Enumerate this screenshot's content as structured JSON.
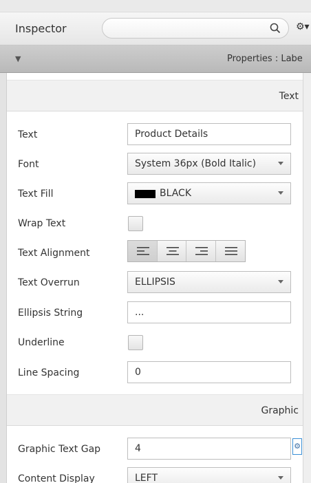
{
  "header": {
    "title": "Inspector",
    "search_placeholder": ""
  },
  "properties_bar": {
    "title": "Properties : Labe"
  },
  "sections": {
    "text": "Text",
    "graphic": "Graphic"
  },
  "fields": {
    "text": {
      "label": "Text",
      "value": "Product Details"
    },
    "font": {
      "label": "Font",
      "value": "System 36px (Bold Italic)"
    },
    "text_fill": {
      "label": "Text Fill",
      "value": "BLACK",
      "swatch_color": "#000000"
    },
    "wrap_text": {
      "label": "Wrap Text",
      "checked": false
    },
    "text_alignment": {
      "label": "Text Alignment",
      "options": [
        "left",
        "center",
        "right",
        "justify"
      ],
      "selected": "left"
    },
    "text_overrun": {
      "label": "Text Overrun",
      "value": "ELLIPSIS"
    },
    "ellipsis_string": {
      "label": "Ellipsis String",
      "value": "..."
    },
    "underline": {
      "label": "Underline",
      "checked": false
    },
    "line_spacing": {
      "label": "Line Spacing",
      "value": "0"
    },
    "graphic_text_gap": {
      "label": "Graphic Text Gap",
      "value": "4"
    },
    "content_display": {
      "label": "Content Display",
      "value": "LEFT"
    }
  },
  "icons": {
    "search": "search-icon",
    "settings": "gear-icon",
    "collapse": "triangle-down-icon"
  }
}
